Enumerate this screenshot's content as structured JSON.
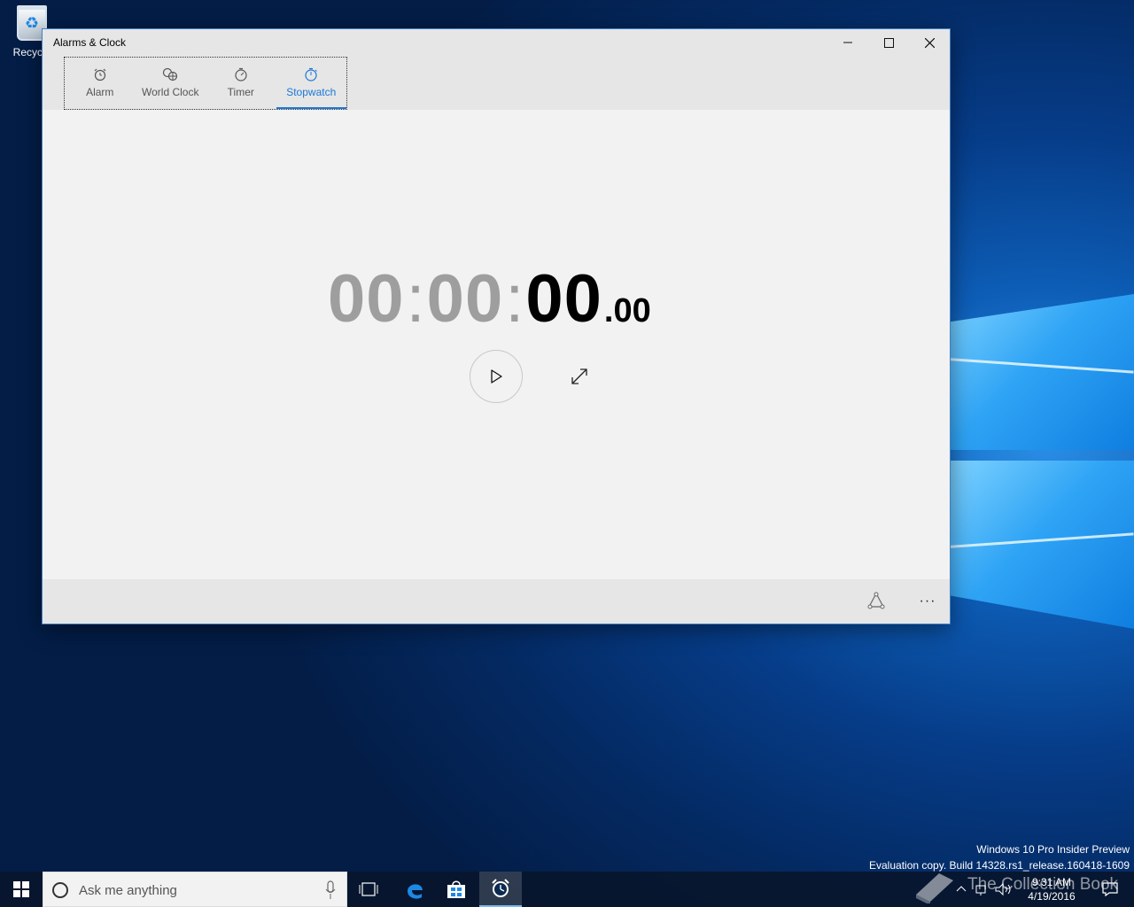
{
  "desktop": {
    "recycle_bin_label": "Recycle",
    "watermark_line1": "Windows 10 Pro Insider Preview",
    "watermark_line2": "Evaluation copy. Build 14328.rs1_release.160418-1609",
    "overlay_text": "The Collection Book"
  },
  "window": {
    "title": "Alarms & Clock",
    "tabs": [
      {
        "label": "Alarm",
        "icon": "alarm-clock-icon",
        "active": false
      },
      {
        "label": "World Clock",
        "icon": "globe-clock-icon",
        "active": false
      },
      {
        "label": "Timer",
        "icon": "timer-icon",
        "active": false
      },
      {
        "label": "Stopwatch",
        "icon": "stopwatch-icon",
        "active": true
      }
    ],
    "stopwatch": {
      "hours": "00",
      "minutes": "00",
      "seconds": "00",
      "fraction": ".00",
      "separator": ":"
    },
    "controls": {
      "play_icon": "play-icon",
      "expand_icon": "expand-icon",
      "pin_icon": "pin-to-start-icon",
      "more_label": "···"
    },
    "colors": {
      "accent": "#1b78d6",
      "dim_digits": "#9e9e9e"
    }
  },
  "taskbar": {
    "search_placeholder": "Ask me anything",
    "time": "9:31 AM",
    "date": "4/19/2016"
  }
}
